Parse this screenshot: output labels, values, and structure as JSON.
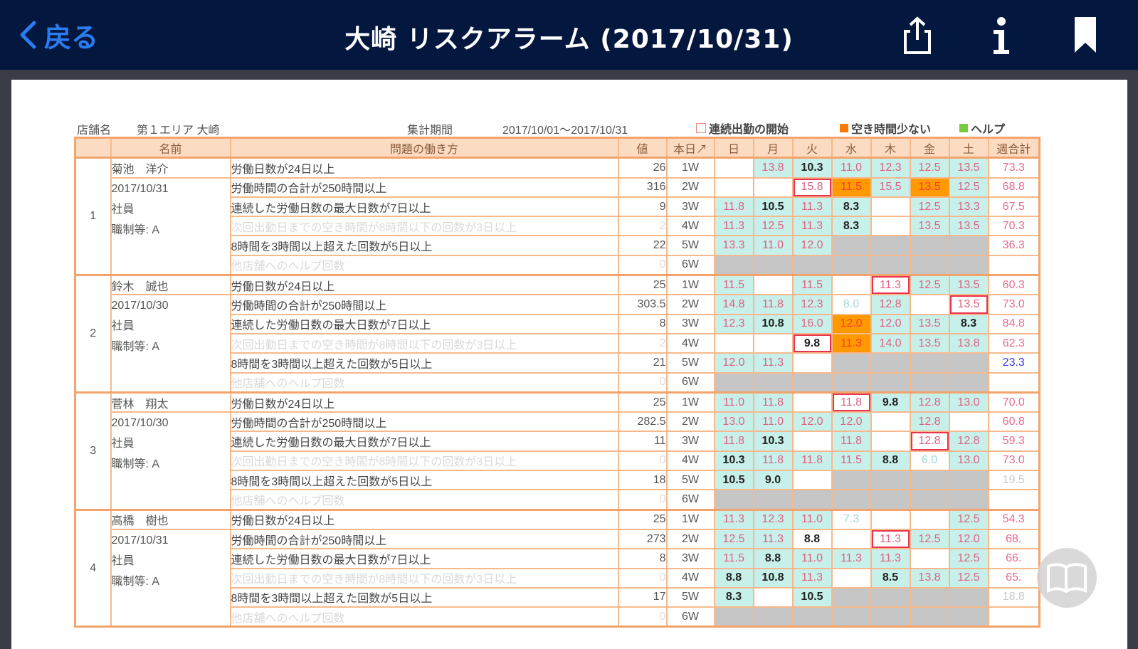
{
  "nav": {
    "back_label": "戻る",
    "title": "大崎 リスクアラーム (2017/10/31)"
  },
  "report": {
    "store_label": "店舗名",
    "store_value": "第１エリア 大崎",
    "period_label": "集計期間",
    "period_value": "2017/10/01～2017/10/31",
    "legend": [
      {
        "label": "連続出勤の開始",
        "color": "#ffffff"
      },
      {
        "label": "空き時間少ない",
        "color": "#ff7a00"
      },
      {
        "label": "ヘルプ",
        "color": "#7ac943"
      }
    ],
    "headers": {
      "name": "名前",
      "problem": "問題の働き方",
      "value": "値",
      "week": "本日↗",
      "days": [
        "日",
        "月",
        "火",
        "水",
        "木",
        "金",
        "土"
      ],
      "total": "週合計"
    },
    "problems": [
      "労働日数が24日以上",
      "労働時間の合計が250時間以上",
      "連続した労働日数の最大日数が7日以上",
      "次回出勤日までの空き時間が8時間以下の回数が3日以上",
      "8時間を3時間以上超えた回数が5日以上",
      "他店舗へのヘルプ回数"
    ],
    "weeks": [
      "1W",
      "2W",
      "3W",
      "4W",
      "5W",
      "6W"
    ],
    "employees": [
      {
        "index": "1",
        "name": "菊池　洋介",
        "date": "2017/10/31",
        "role": "社員",
        "rank": "職制等: A",
        "values": [
          "26",
          "316",
          "9",
          "2",
          "22",
          "0"
        ],
        "totals": [
          "73.3",
          "68.8",
          "67.5",
          "70.3",
          "36.3",
          ""
        ],
        "cells": [
          [
            "",
            "13.8",
            "10.3",
            "11.0",
            "12.3",
            "12.5",
            "13.5"
          ],
          [
            "",
            "",
            "15.8",
            "11.5",
            "15.5",
            "13.5",
            "12.5"
          ],
          [
            "11.8",
            "10.5",
            "11.3",
            "8.3",
            "",
            "12.5",
            "13.3"
          ],
          [
            "11.3",
            "12.5",
            "11.3",
            "8.3",
            "",
            "13.5",
            "13.5"
          ],
          [
            "13.3",
            "11.0",
            "12.0",
            "",
            "",
            "",
            ""
          ],
          [
            "",
            "",
            "",
            "",
            "",
            "",
            ""
          ]
        ]
      },
      {
        "index": "2",
        "name": "鈴木　誠也",
        "date": "2017/10/30",
        "role": "社員",
        "rank": "職制等: A",
        "values": [
          "25",
          "303.5",
          "8",
          "2",
          "21",
          "0"
        ],
        "totals": [
          "60.3",
          "73.0",
          "84.8",
          "62.3",
          "23.3",
          ""
        ],
        "cells": [
          [
            "11.5",
            "",
            "11.5",
            "",
            "11.3",
            "12.5",
            "13.5"
          ],
          [
            "14.8",
            "11.8",
            "12.3",
            "8.0",
            "12.8",
            "",
            "13.5"
          ],
          [
            "12.3",
            "10.8",
            "16.0",
            "12.0",
            "12.0",
            "13.5",
            "8.3"
          ],
          [
            "",
            "",
            "9.8",
            "11.3",
            "14.0",
            "13.5",
            "13.8"
          ],
          [
            "12.0",
            "11.3",
            "",
            "",
            "",
            "",
            ""
          ],
          [
            "",
            "",
            "",
            "",
            "",
            "",
            ""
          ]
        ]
      },
      {
        "index": "3",
        "name": "菅林　翔太",
        "date": "2017/10/30",
        "role": "社員",
        "rank": "職制等: A",
        "values": [
          "25",
          "282.5",
          "11",
          "0",
          "18",
          "0"
        ],
        "totals": [
          "70.0",
          "60.8",
          "59.3",
          "73.0",
          "19.5",
          ""
        ],
        "cells": [
          [
            "11.0",
            "11.8",
            "",
            "11.8",
            "9.8",
            "12.8",
            "13.0"
          ],
          [
            "13.0",
            "11.0",
            "12.0",
            "12.0",
            "",
            "12.8",
            ""
          ],
          [
            "11.8",
            "10.3",
            "",
            "11.8",
            "",
            "12.8",
            "12.8"
          ],
          [
            "10.3",
            "11.8",
            "11.8",
            "11.5",
            "8.8",
            "6.0",
            "13.0"
          ],
          [
            "10.5",
            "9.0",
            "",
            "",
            "",
            "",
            ""
          ],
          [
            "",
            "",
            "",
            "",
            "",
            "",
            ""
          ]
        ]
      },
      {
        "index": "4",
        "name": "高橋　樹也",
        "date": "2017/10/31",
        "role": "社員",
        "rank": "職制等: A",
        "values": [
          "25",
          "273",
          "8",
          "0",
          "17",
          "0"
        ],
        "totals": [
          "54.3",
          "68.",
          "66.",
          "65.",
          "18.8",
          ""
        ],
        "cells": [
          [
            "11.3",
            "12.3",
            "11.0",
            "7.3",
            "",
            "",
            "12.5"
          ],
          [
            "12.5",
            "11.3",
            "8.8",
            "",
            "11.3",
            "12.5",
            "12.0"
          ],
          [
            "11.5",
            "8.8",
            "11.0",
            "11.3",
            "11.3",
            "",
            "12.5"
          ],
          [
            "8.8",
            "10.8",
            "11.3",
            "",
            "8.5",
            "13.8",
            "12.5"
          ],
          [
            "8.3",
            "",
            "10.5",
            "",
            "",
            "",
            ""
          ],
          [
            "",
            "",
            "",
            "",
            "",
            "",
            ""
          ]
        ]
      }
    ]
  }
}
